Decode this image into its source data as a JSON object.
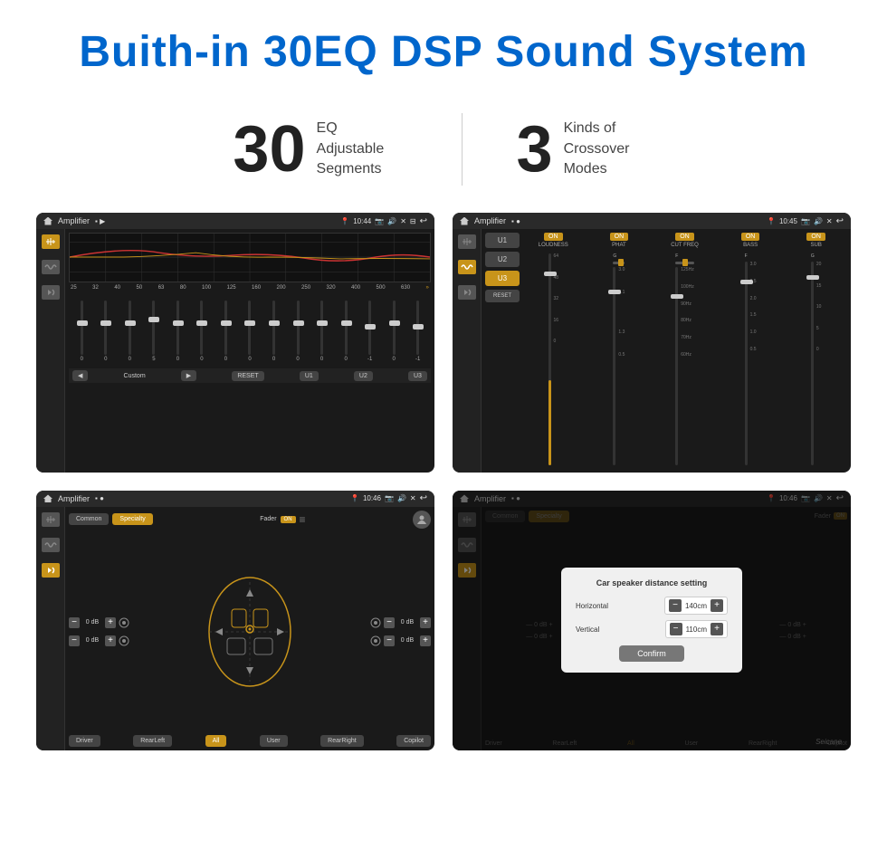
{
  "header": {
    "title": "Buith-in 30EQ DSP Sound System"
  },
  "stats": {
    "eq_number": "30",
    "eq_label": "EQ Adjustable\nSegments",
    "crossover_number": "3",
    "crossover_label": "Kinds of\nCrossover Modes"
  },
  "screens": {
    "eq": {
      "title": "Amplifier",
      "time": "10:44",
      "frequencies": [
        "25",
        "32",
        "40",
        "50",
        "63",
        "80",
        "100",
        "125",
        "160",
        "200",
        "250",
        "320",
        "400",
        "500",
        "630"
      ],
      "values": [
        "0",
        "0",
        "0",
        "0",
        "5",
        "0",
        "0",
        "0",
        "0",
        "0",
        "0",
        "0",
        "-1",
        "0",
        "-1"
      ],
      "sliders": [
        50,
        50,
        50,
        55,
        62,
        50,
        50,
        50,
        50,
        50,
        50,
        50,
        45,
        50,
        45
      ],
      "buttons": [
        "Custom",
        "RESET",
        "U1",
        "U2",
        "U3"
      ]
    },
    "crossover": {
      "title": "Amplifier",
      "time": "10:45",
      "presets": [
        "U1",
        "U2",
        "U3"
      ],
      "active_preset": "U3",
      "channels": [
        {
          "label": "LOUDNESS",
          "on": true
        },
        {
          "label": "PHAT",
          "on": true
        },
        {
          "label": "CUT FREQ",
          "on": true
        },
        {
          "label": "BASS",
          "on": true
        },
        {
          "label": "SUB",
          "on": true
        }
      ],
      "reset_btn": "RESET"
    },
    "speaker": {
      "title": "Amplifier",
      "time": "10:46",
      "presets": [
        "Common",
        "Specialty"
      ],
      "active_preset": "Specialty",
      "fader": "Fader",
      "fader_on": "ON",
      "db_values": [
        "0 dB",
        "0 dB",
        "0 dB",
        "0 dB"
      ],
      "bottom_btns": [
        "Driver",
        "RearLeft",
        "All",
        "User",
        "RearRight",
        "Copilot"
      ],
      "active_bottom": "All"
    },
    "distance": {
      "title": "Amplifier",
      "time": "10:46",
      "dialog_title": "Car speaker distance setting",
      "horizontal_label": "Horizontal",
      "horizontal_value": "140cm",
      "vertical_label": "Vertical",
      "vertical_value": "110cm",
      "confirm_label": "Confirm",
      "db_values": [
        "0 dB",
        "0 dB"
      ],
      "bottom_btns": [
        "Driver",
        "RearLeft",
        "All",
        "User",
        "RearRight",
        "Copilot"
      ]
    }
  },
  "watermark": "Seicane"
}
